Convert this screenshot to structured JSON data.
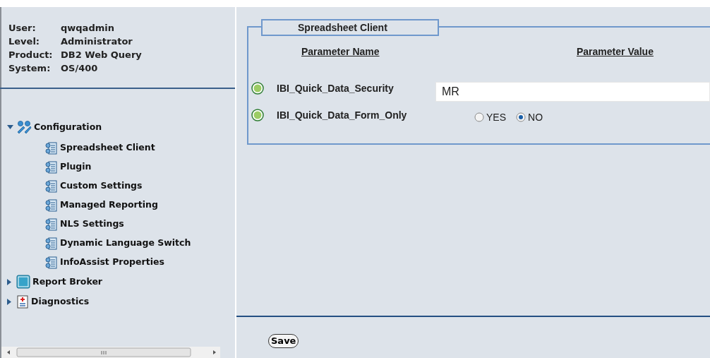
{
  "user_info": [
    {
      "label": "User:",
      "value": "qwqadmin"
    },
    {
      "label": "Level:",
      "value": "Administrator"
    },
    {
      "label": "Product:",
      "value": "DB2 Web Query"
    },
    {
      "label": "System:",
      "value": "OS/400"
    }
  ],
  "tree": [
    {
      "label": "Configuration",
      "kind": "tools",
      "expanded": true,
      "children": [
        {
          "label": "Spreadsheet Client",
          "kind": "config"
        },
        {
          "label": "Plugin",
          "kind": "config"
        },
        {
          "label": "Custom Settings",
          "kind": "config"
        },
        {
          "label": "Managed Reporting",
          "kind": "config"
        },
        {
          "label": "NLS Settings",
          "kind": "config"
        },
        {
          "label": "Dynamic Language Switch",
          "kind": "config"
        },
        {
          "label": "InfoAssist Properties",
          "kind": "config"
        }
      ]
    },
    {
      "label": "Report Broker",
      "kind": "rc",
      "expanded": false
    },
    {
      "label": "Diagnostics",
      "kind": "diag",
      "expanded": false
    }
  ],
  "panel": {
    "title": "Spreadsheet Client",
    "columns": [
      "Parameter Name",
      "Parameter Value"
    ],
    "parameters": [
      {
        "name": "IBI_Quick_Data_Security",
        "kind": "text",
        "value": "MR"
      },
      {
        "name": "IBI_Quick_Data_Form_Only",
        "kind": "radio",
        "options": [
          {
            "label": "YES",
            "selected": false
          },
          {
            "label": "NO",
            "selected": true
          }
        ]
      }
    ]
  },
  "save_button": "Save"
}
